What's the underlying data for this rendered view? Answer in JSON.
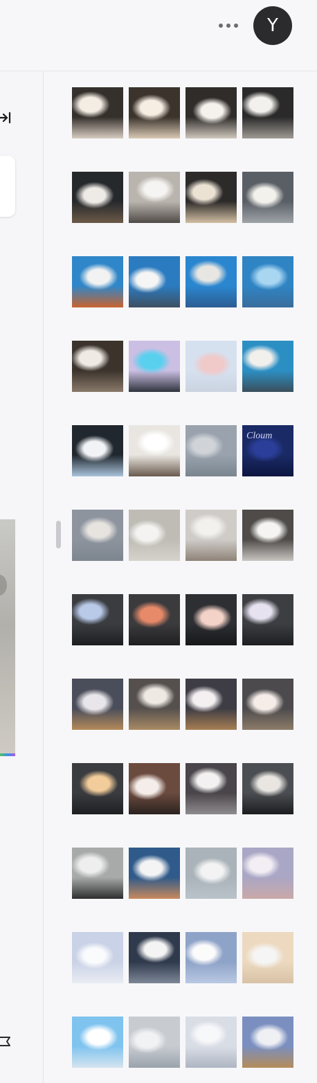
{
  "header": {
    "more_icon": "more-horizontal-icon",
    "avatar_letter": "Y"
  },
  "left_panel": {
    "collapse_icon": "collapse-panel-icon",
    "flag_icon": "flag-icon"
  },
  "gallery": {
    "rows": [
      [
        {
          "top": "#35302c",
          "bottom": "#d7ccc0",
          "cloud": "#f4ede4"
        },
        {
          "top": "#3b332c",
          "bottom": "#d9c9b4",
          "cloud": "#f6eee2"
        },
        {
          "top": "#2f2c2a",
          "bottom": "#cfc7bd",
          "cloud": "#f5f1ec"
        },
        {
          "top": "#2a2a2a",
          "bottom": "#9f9a93",
          "cloud": "#f3f1ee"
        }
      ],
      [
        {
          "top": "#26292c",
          "bottom": "#6c5a48",
          "cloud": "#eeeae6"
        },
        {
          "top": "#b9b4ad",
          "bottom": "#4f4a47",
          "cloud": "#f6f4f2"
        },
        {
          "top": "#2d2b2a",
          "bottom": "#d3bfa3",
          "cloud": "#ece2d4"
        },
        {
          "top": "#5a5f66",
          "bottom": "#9ea3a8",
          "cloud": "#f3f1ec"
        }
      ],
      [
        {
          "top": "#2f86c8",
          "bottom": "#c9642f",
          "cloud": "#f2f2f2"
        },
        {
          "top": "#2b7bc0",
          "bottom": "#3e4f60",
          "cloud": "#f5f5f5"
        },
        {
          "top": "#2a86cf",
          "bottom": "#2c5d92",
          "cloud": "#e8e6e2"
        },
        {
          "top": "#2f84c4",
          "bottom": "#3a6d9c",
          "cloud": "#a9d7f2"
        }
      ],
      [
        {
          "top": "#3b332c",
          "bottom": "#8a7a6a",
          "cloud": "#efeae4"
        },
        {
          "top": "#cbbfe4",
          "bottom": "#30343d",
          "cloud": "#5ad0ef"
        },
        {
          "top": "#d6e1f0",
          "bottom": "#cbd3e0",
          "cloud": "#f0c9c9"
        },
        {
          "top": "#2c8fc4",
          "bottom": "#3a4f5c",
          "cloud": "#f2f0ec"
        }
      ],
      [
        {
          "top": "#20272e",
          "bottom": "#a9c2da",
          "cloud": "#f1f3f6"
        },
        {
          "top": "#e9e6e1",
          "bottom": "#6a5a4d",
          "cloud": "#ffffff"
        },
        {
          "top": "#9aa3ad",
          "bottom": "#7b858f",
          "cloud": "#d0d4d9"
        },
        {
          "top": "#1a2a66",
          "bottom": "#0d1640",
          "cloud": "#2b3f9a",
          "label": "Cloum"
        }
      ],
      [
        {
          "top": "#8d949e",
          "bottom": "#7d858f",
          "cloud": "#e7e4e0"
        },
        {
          "top": "#bfbcb5",
          "bottom": "#d6d2cc",
          "cloud": "#f4f3f1"
        },
        {
          "top": "#cfccc8",
          "bottom": "#8f8378",
          "cloud": "#f3f1ee"
        },
        {
          "top": "#4e4b48",
          "bottom": "#c9c6c2",
          "cloud": "#f5f4f2"
        }
      ],
      [
        {
          "top": "#3a3c40",
          "bottom": "#1d1e21",
          "cloud": "#b9c9e8"
        },
        {
          "top": "#3b3b3e",
          "bottom": "#1f1f22",
          "cloud": "#e78a6a"
        },
        {
          "top": "#2e2f33",
          "bottom": "#17181a",
          "cloud": "#f3d2c8"
        },
        {
          "top": "#3c3e42",
          "bottom": "#1e1f21",
          "cloud": "#e7e2f0"
        }
      ],
      [
        {
          "top": "#4a4d5a",
          "bottom": "#b48a5a",
          "cloud": "#e8e6ea"
        },
        {
          "top": "#55504e",
          "bottom": "#a98a64",
          "cloud": "#efe9e4"
        },
        {
          "top": "#3e3c44",
          "bottom": "#a77f53",
          "cloud": "#f4f0f2"
        },
        {
          "top": "#4c4a4c",
          "bottom": "#8d7c69",
          "cloud": "#f6ede9"
        }
      ],
      [
        {
          "top": "#3b3c40",
          "bottom": "#1e1f22",
          "cloud": "#f2cc9a"
        },
        {
          "top": "#6c4b3f",
          "bottom": "#2a2220",
          "cloud": "#f4ede9"
        },
        {
          "top": "#4a454a",
          "bottom": "#8f8c8e",
          "cloud": "#f3f1f2"
        },
        {
          "top": "#4b4e52",
          "bottom": "#1c1d20",
          "cloud": "#e9e6e2"
        }
      ],
      [
        {
          "top": "#a7aaa9",
          "bottom": "#2e2e2e",
          "cloud": "#eeeeee"
        },
        {
          "top": "#2f5a8a",
          "bottom": "#c98a5c",
          "cloud": "#f4f4f4"
        },
        {
          "top": "#a9b3b9",
          "bottom": "#b9c3c9",
          "cloud": "#f3f3f3"
        },
        {
          "top": "#aaa6c5",
          "bottom": "#c9a9a7",
          "cloud": "#f2eef4"
        }
      ],
      [
        {
          "top": "#c9d2e6",
          "bottom": "#e8ecf3",
          "cloud": "#fafbfd"
        },
        {
          "top": "#2f3a4c",
          "bottom": "#7d8797",
          "cloud": "#f4f4f4"
        },
        {
          "top": "#8ea3c8",
          "bottom": "#b9c8e3",
          "cloud": "#fbfbfc"
        },
        {
          "top": "#ecd9bf",
          "bottom": "#d8c2a6",
          "cloud": "#f5f5f5"
        }
      ],
      [
        {
          "top": "#7fc3ef",
          "bottom": "#d5e4ef",
          "cloud": "#ffffff"
        },
        {
          "top": "#c8ccd1",
          "bottom": "#9aa2ab",
          "cloud": "#f1f2f4"
        },
        {
          "top": "#d9dde6",
          "bottom": "#aeb6c2",
          "cloud": "#f7f8fa"
        },
        {
          "top": "#7a8fbf",
          "bottom": "#b48c59",
          "cloud": "#eef0f4"
        }
      ]
    ]
  }
}
